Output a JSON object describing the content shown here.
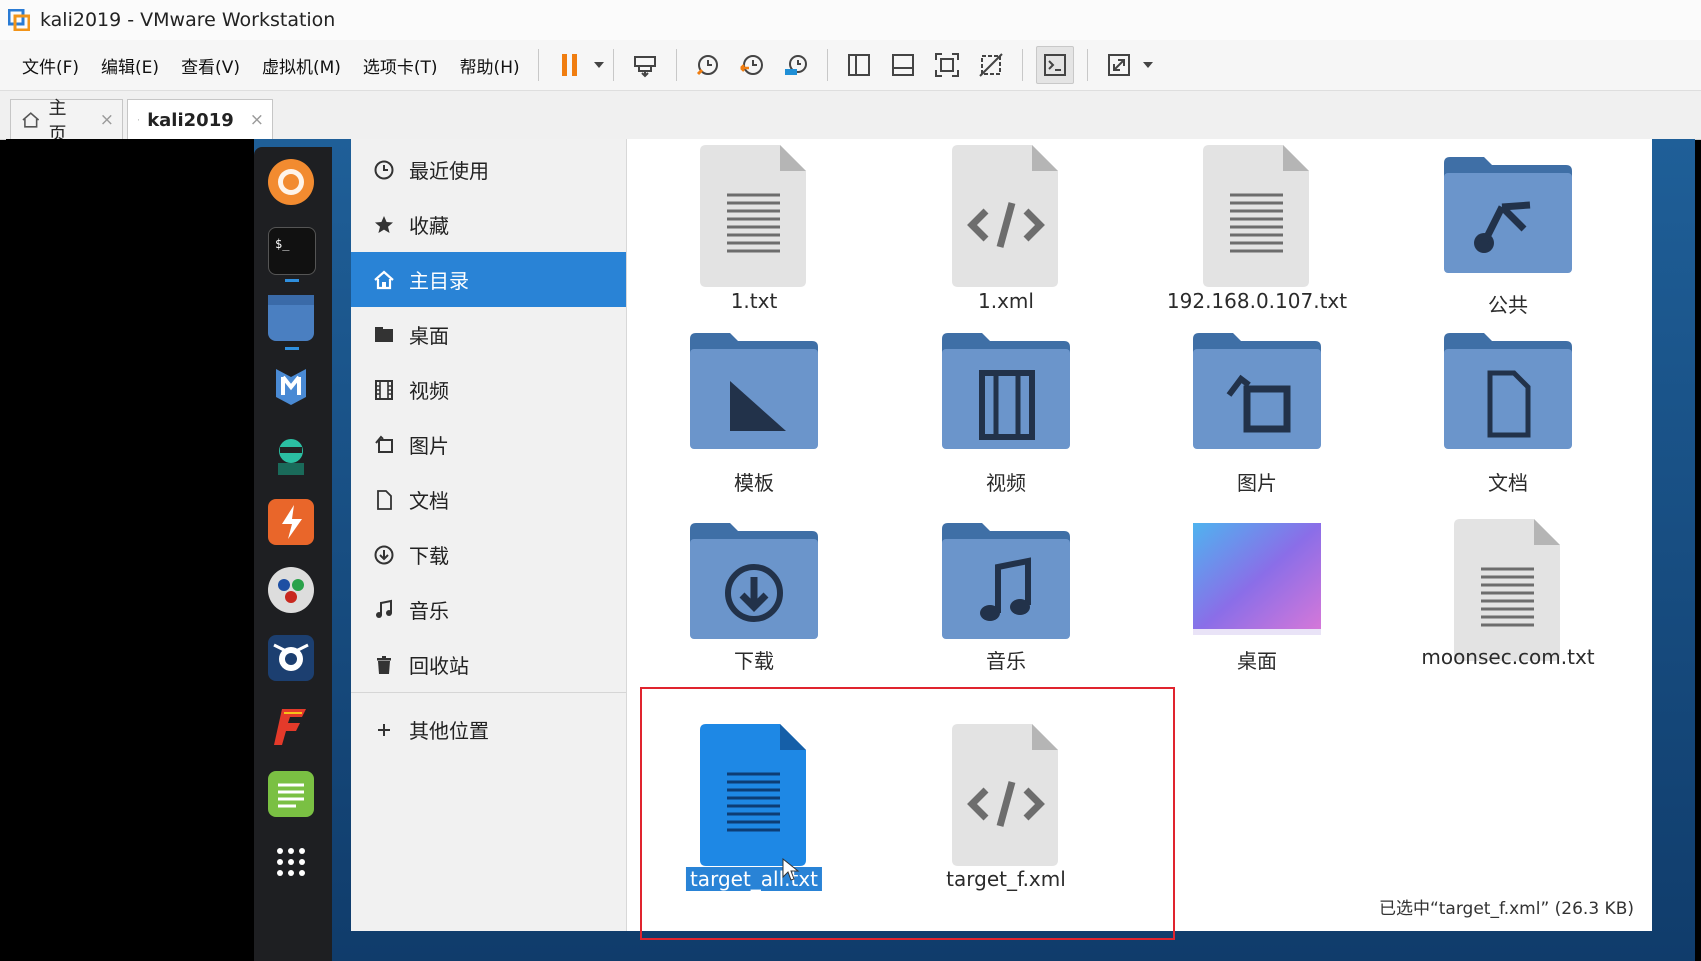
{
  "window": {
    "title": "kali2019 - VMware Workstation"
  },
  "menu": [
    "文件(F)",
    "编辑(E)",
    "查看(V)",
    "虚拟机(M)",
    "选项卡(T)",
    "帮助(H)"
  ],
  "toolbar_icons": [
    "pause-icon",
    "send-ctrl-alt-del-icon",
    "snapshot-icon",
    "revert-snapshot-icon",
    "snapshot-manager-icon",
    "library-icon",
    "thumbnail-bar-icon",
    "fit-guest-icon",
    "unity-icon",
    "console-view-icon",
    "fullscreen-icon"
  ],
  "tabs": [
    {
      "label": "主页",
      "close": "×"
    },
    {
      "label": "kali2019",
      "close": "×"
    }
  ],
  "sidebar": {
    "items": [
      {
        "label": "最近使用",
        "icon": "clock-icon"
      },
      {
        "label": "收藏",
        "icon": "star-icon"
      },
      {
        "label": "主目录",
        "icon": "home-icon",
        "active": true
      },
      {
        "label": "桌面",
        "icon": "desktop-folder-icon"
      },
      {
        "label": "视频",
        "icon": "video-icon"
      },
      {
        "label": "图片",
        "icon": "picture-icon"
      },
      {
        "label": "文档",
        "icon": "document-icon"
      },
      {
        "label": "下载",
        "icon": "download-icon"
      },
      {
        "label": "音乐",
        "icon": "music-icon"
      },
      {
        "label": "回收站",
        "icon": "trash-icon"
      }
    ],
    "other": {
      "label": "其他位置",
      "icon": "plus-icon"
    }
  },
  "files": [
    {
      "name": "1.txt",
      "type": "text"
    },
    {
      "name": "1.xml",
      "type": "xml"
    },
    {
      "name": "192.168.0.107.txt",
      "type": "text"
    },
    {
      "name": "公共",
      "type": "folder-public"
    },
    {
      "name": "模板",
      "type": "folder-templates"
    },
    {
      "name": "视频",
      "type": "folder-videos"
    },
    {
      "name": "图片",
      "type": "folder-pictures"
    },
    {
      "name": "文档",
      "type": "folder-documents"
    },
    {
      "name": "下载",
      "type": "folder-downloads"
    },
    {
      "name": "音乐",
      "type": "folder-music"
    },
    {
      "name": "桌面",
      "type": "folder-desktop"
    },
    {
      "name": "moonsec.com.txt",
      "type": "text"
    },
    {
      "name": "target_all.txt",
      "type": "text-selected"
    },
    {
      "name": "target_f.xml",
      "type": "xml"
    }
  ],
  "status": "已选中“target_f.xml” (26.3 KB)",
  "colors": {
    "accent": "#2983d6",
    "folder": "#6b95cb",
    "highlight_box": "#e0242e"
  }
}
